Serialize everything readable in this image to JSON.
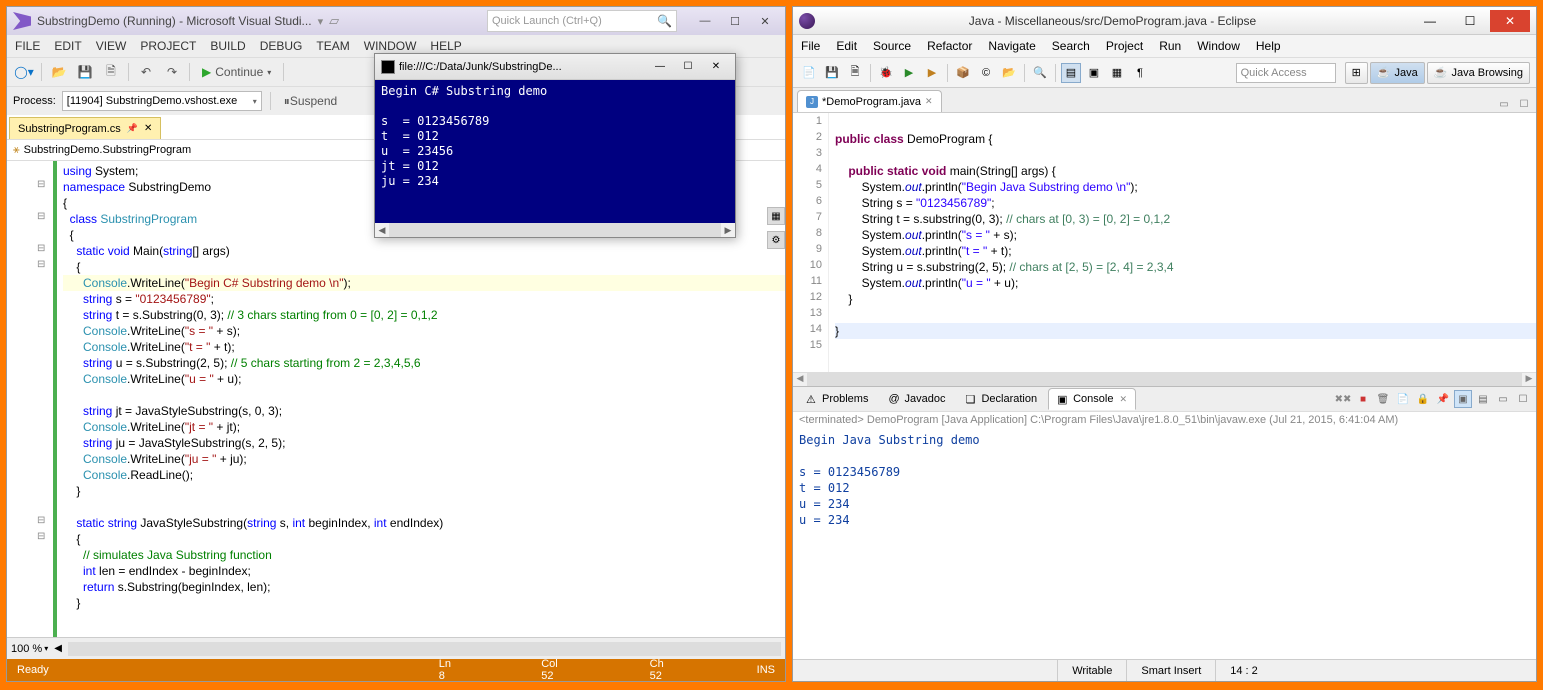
{
  "vs": {
    "title": "SubstringDemo (Running) - Microsoft Visual Studi...",
    "search_placeholder": "Quick Launch (Ctrl+Q)",
    "menu1": [
      "FILE",
      "EDIT",
      "VIEW",
      "PROJECT",
      "BUILD",
      "DEBUG",
      "TEAM"
    ],
    "menu2": [
      "WINDOW",
      "HELP"
    ],
    "continue_label": "Continue",
    "process_label": "Process:",
    "process_value": "[11904] SubstringDemo.vshost.exe",
    "suspend_label": "Suspend",
    "tab_label": "SubstringProgram.cs",
    "crumb": "SubstringDemo.SubstringProgram",
    "zoom": "100 %",
    "status": {
      "ready": "Ready",
      "ln": "Ln 8",
      "col": "Col 52",
      "ch": "Ch 52",
      "ins": "INS"
    },
    "code": [
      {
        "t": "using System;",
        "cls": "",
        "parts": [
          [
            "kw",
            "using"
          ],
          "",
          " System;"
        ]
      },
      {
        "parts": [
          [
            "kw",
            "namespace"
          ],
          "",
          " SubstringDemo"
        ]
      },
      {
        "parts": [
          "{"
        ]
      },
      {
        "parts": [
          "  ",
          [
            "kw",
            "class"
          ],
          "",
          " ",
          [
            "typ",
            "SubstringProgram"
          ]
        ]
      },
      {
        "parts": [
          "  {"
        ]
      },
      {
        "parts": [
          "    ",
          [
            "kw",
            "static"
          ],
          "",
          " ",
          [
            "kw",
            "void"
          ],
          "",
          " Main(",
          [
            "kw",
            "string"
          ],
          "[] args)"
        ]
      },
      {
        "parts": [
          "    {"
        ]
      },
      {
        "hl": true,
        "parts": [
          "      ",
          [
            "typ",
            "Console"
          ],
          ".WriteLine(",
          [
            "str",
            "\"Begin C# Substring demo \\n\""
          ],
          ");"
        ]
      },
      {
        "parts": [
          "      ",
          [
            "kw",
            "string"
          ],
          "",
          " s = ",
          [
            "str",
            "\"0123456789\""
          ],
          ";"
        ]
      },
      {
        "parts": [
          "      ",
          [
            "kw",
            "string"
          ],
          "",
          " t = s.Substring(0, 3); ",
          [
            "com",
            "// 3 chars starting from 0 = [0, 2] = 0,1,2"
          ]
        ]
      },
      {
        "parts": [
          "      ",
          [
            "typ",
            "Console"
          ],
          ".WriteLine(",
          [
            "str",
            "\"s = \""
          ],
          " + s);"
        ]
      },
      {
        "parts": [
          "      ",
          [
            "typ",
            "Console"
          ],
          ".WriteLine(",
          [
            "str",
            "\"t = \""
          ],
          " + t);"
        ]
      },
      {
        "parts": [
          "      ",
          [
            "kw",
            "string"
          ],
          "",
          " u = s.Substring(2, 5); ",
          [
            "com",
            "// 5 chars starting from 2 = 2,3,4,5,6"
          ]
        ]
      },
      {
        "parts": [
          "      ",
          [
            "typ",
            "Console"
          ],
          ".WriteLine(",
          [
            "str",
            "\"u = \""
          ],
          " + u);"
        ]
      },
      {
        "parts": [
          ""
        ]
      },
      {
        "parts": [
          "      ",
          [
            "kw",
            "string"
          ],
          "",
          " jt = JavaStyleSubstring(s, 0, 3);"
        ]
      },
      {
        "parts": [
          "      ",
          [
            "typ",
            "Console"
          ],
          ".WriteLine(",
          [
            "str",
            "\"jt = \""
          ],
          " + jt);"
        ]
      },
      {
        "parts": [
          "      ",
          [
            "kw",
            "string"
          ],
          "",
          " ju = JavaStyleSubstring(s, 2, 5);"
        ]
      },
      {
        "parts": [
          "      ",
          [
            "typ",
            "Console"
          ],
          ".WriteLine(",
          [
            "str",
            "\"ju = \""
          ],
          " + ju);"
        ]
      },
      {
        "parts": [
          "      ",
          [
            "typ",
            "Console"
          ],
          ".ReadLine();"
        ]
      },
      {
        "parts": [
          "    }"
        ]
      },
      {
        "parts": [
          ""
        ]
      },
      {
        "parts": [
          "    ",
          [
            "kw",
            "static"
          ],
          "",
          " ",
          [
            "kw",
            "string"
          ],
          "",
          " JavaStyleSubstring(",
          [
            "kw",
            "string"
          ],
          "",
          " s, ",
          [
            "kw",
            "int"
          ],
          "",
          " beginIndex, ",
          [
            "kw",
            "int"
          ],
          "",
          " endIndex)"
        ]
      },
      {
        "parts": [
          "    {"
        ]
      },
      {
        "parts": [
          "      ",
          [
            "com",
            "// simulates Java Substring function"
          ]
        ]
      },
      {
        "parts": [
          "      ",
          [
            "kw",
            "int"
          ],
          "",
          " len = endIndex - beginIndex;"
        ]
      },
      {
        "parts": [
          "      ",
          [
            "kw",
            "return"
          ],
          "",
          " s.Substring(beginIndex, len);"
        ]
      },
      {
        "parts": [
          "    }"
        ]
      }
    ],
    "console": {
      "title": "file:///C:/Data/Junk/SubstringDe...",
      "lines": [
        "Begin C# Substring demo",
        "",
        "s  = 0123456789",
        "t  = 012",
        "u  = 23456",
        "jt = 012",
        "ju = 234"
      ]
    }
  },
  "ec": {
    "title": "Java - Miscellaneous/src/DemoProgram.java - Eclipse",
    "menu": [
      "File",
      "Edit",
      "Source",
      "Refactor",
      "Navigate",
      "Search",
      "Project",
      "Run",
      "Window",
      "Help"
    ],
    "quick": "Quick Access",
    "persp": [
      {
        "label": "Java",
        "active": true
      },
      {
        "label": "Java Browsing",
        "active": false
      }
    ],
    "editor_tab": "*DemoProgram.java",
    "lines": 15,
    "code": [
      {
        "n": 1,
        "parts": [
          ""
        ]
      },
      {
        "n": 2,
        "parts": [
          [
            "jkw",
            "public class"
          ],
          "",
          " DemoProgram {"
        ]
      },
      {
        "n": 3,
        "parts": [
          ""
        ]
      },
      {
        "n": 4,
        "parts": [
          "    ",
          [
            "jkw",
            "public static void"
          ],
          "",
          " main(String[] args) {"
        ]
      },
      {
        "n": 5,
        "parts": [
          "        System.",
          [
            "jfield",
            "out"
          ],
          ".println(",
          [
            "jstr",
            "\"Begin Java Substring demo \\n\""
          ],
          ");"
        ]
      },
      {
        "n": 6,
        "parts": [
          "        String s = ",
          [
            "jstr",
            "\"0123456789\""
          ],
          ";"
        ]
      },
      {
        "n": 7,
        "parts": [
          "        String t = s.substring(0, 3); ",
          [
            "jcom",
            "// chars at [0, 3) = [0, 2] = 0,1,2"
          ]
        ]
      },
      {
        "n": 8,
        "parts": [
          "        System.",
          [
            "jfield",
            "out"
          ],
          ".println(",
          [
            "jstr",
            "\"s = \""
          ],
          " + s);"
        ]
      },
      {
        "n": 9,
        "parts": [
          "        System.",
          [
            "jfield",
            "out"
          ],
          ".println(",
          [
            "jstr",
            "\"t = \""
          ],
          " + t);"
        ]
      },
      {
        "n": 10,
        "parts": [
          "        String u = s.substring(2, 5); ",
          [
            "jcom",
            "// chars at [2, 5) = [2, 4] = 2,3,4"
          ]
        ]
      },
      {
        "n": 11,
        "parts": [
          "        System.",
          [
            "jfield",
            "out"
          ],
          ".println(",
          [
            "jstr",
            "\"u = \""
          ],
          " + u);"
        ]
      },
      {
        "n": 12,
        "parts": [
          "    }"
        ]
      },
      {
        "n": 13,
        "parts": [
          ""
        ]
      },
      {
        "n": 14,
        "cur": true,
        "parts": [
          "}"
        ]
      },
      {
        "n": 15,
        "parts": [
          ""
        ]
      }
    ],
    "views": [
      "Problems",
      "Javadoc",
      "Declaration",
      "Console"
    ],
    "active_view": 3,
    "terminated": "<terminated> DemoProgram [Java Application] C:\\Program Files\\Java\\jre1.8.0_51\\bin\\javaw.exe (Jul 21, 2015, 6:41:04 AM)",
    "console_out": [
      "Begin Java Substring demo",
      "",
      "s = 0123456789",
      "t = 012",
      "u = 234",
      "u = 234"
    ],
    "status": {
      "writable": "Writable",
      "insert": "Smart Insert",
      "pos": "14 : 2"
    }
  }
}
